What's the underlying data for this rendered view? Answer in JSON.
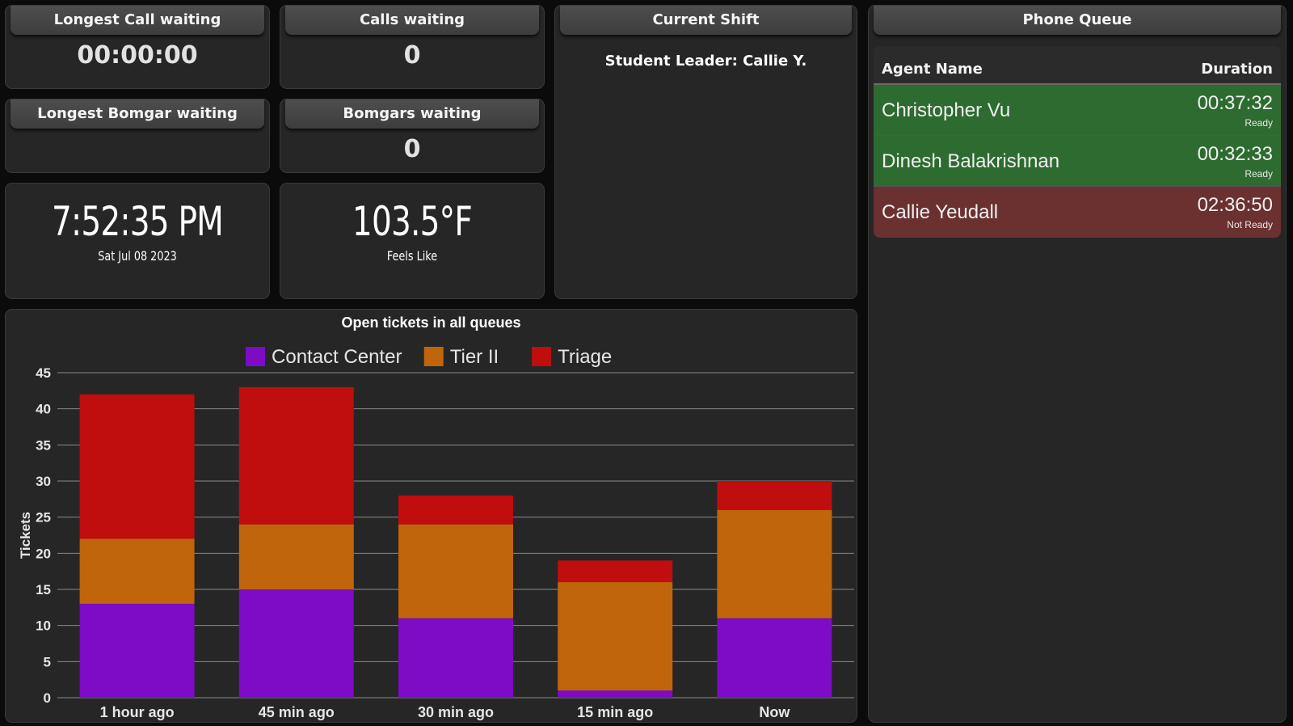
{
  "tiles": {
    "longest_call": {
      "title": "Longest Call waiting",
      "value": "00:00:00"
    },
    "calls_waiting": {
      "title": "Calls waiting",
      "value": "0"
    },
    "longest_bomgar": {
      "title": "Longest Bomgar waiting",
      "value": ""
    },
    "bomgars_waiting": {
      "title": "Bomgars waiting",
      "value": "0"
    }
  },
  "clock": {
    "time": "7:52:35 PM",
    "date": "Sat Jul 08 2023"
  },
  "weather": {
    "temp": "103.5°F",
    "label": "Feels Like"
  },
  "shift": {
    "title": "Current Shift",
    "leader": "Student Leader: Callie Y."
  },
  "phone_queue": {
    "title": "Phone Queue",
    "col_agent": "Agent Name",
    "col_duration": "Duration",
    "agents": [
      {
        "name": "Christopher Vu",
        "duration": "00:37:32",
        "status": "Ready"
      },
      {
        "name": "Dinesh Balakrishnan",
        "duration": "00:32:33",
        "status": "Ready"
      },
      {
        "name": "Callie Yeudall",
        "duration": "02:36:50",
        "status": "Not Ready"
      }
    ]
  },
  "colors": {
    "ready": "#2e6b30",
    "not_ready": "#6b3030",
    "contact_center": "#7e0bc6",
    "tier_ii": "#c0650b",
    "triage": "#c00d0d"
  },
  "chart_data": {
    "type": "bar",
    "stacked": true,
    "title": "Open tickets in all queues",
    "ylabel": "Tickets",
    "xlabel": "",
    "ylim": [
      0,
      45
    ],
    "yticks": [
      "0",
      "5",
      "10",
      "15",
      "20",
      "25",
      "30",
      "35",
      "40",
      "45"
    ],
    "categories": [
      "1 hour ago",
      "45 min ago",
      "30 min ago",
      "15 min ago",
      "Now"
    ],
    "legend_position": "top",
    "grid": true,
    "series": [
      {
        "name": "Contact Center",
        "color": "#7e0bc6",
        "values": [
          13,
          15,
          11,
          1,
          11
        ]
      },
      {
        "name": "Tier II",
        "color": "#c0650b",
        "values": [
          9,
          9,
          13,
          15,
          15
        ]
      },
      {
        "name": "Triage",
        "color": "#c00d0d",
        "values": [
          20,
          19,
          4,
          3,
          4
        ]
      }
    ]
  }
}
